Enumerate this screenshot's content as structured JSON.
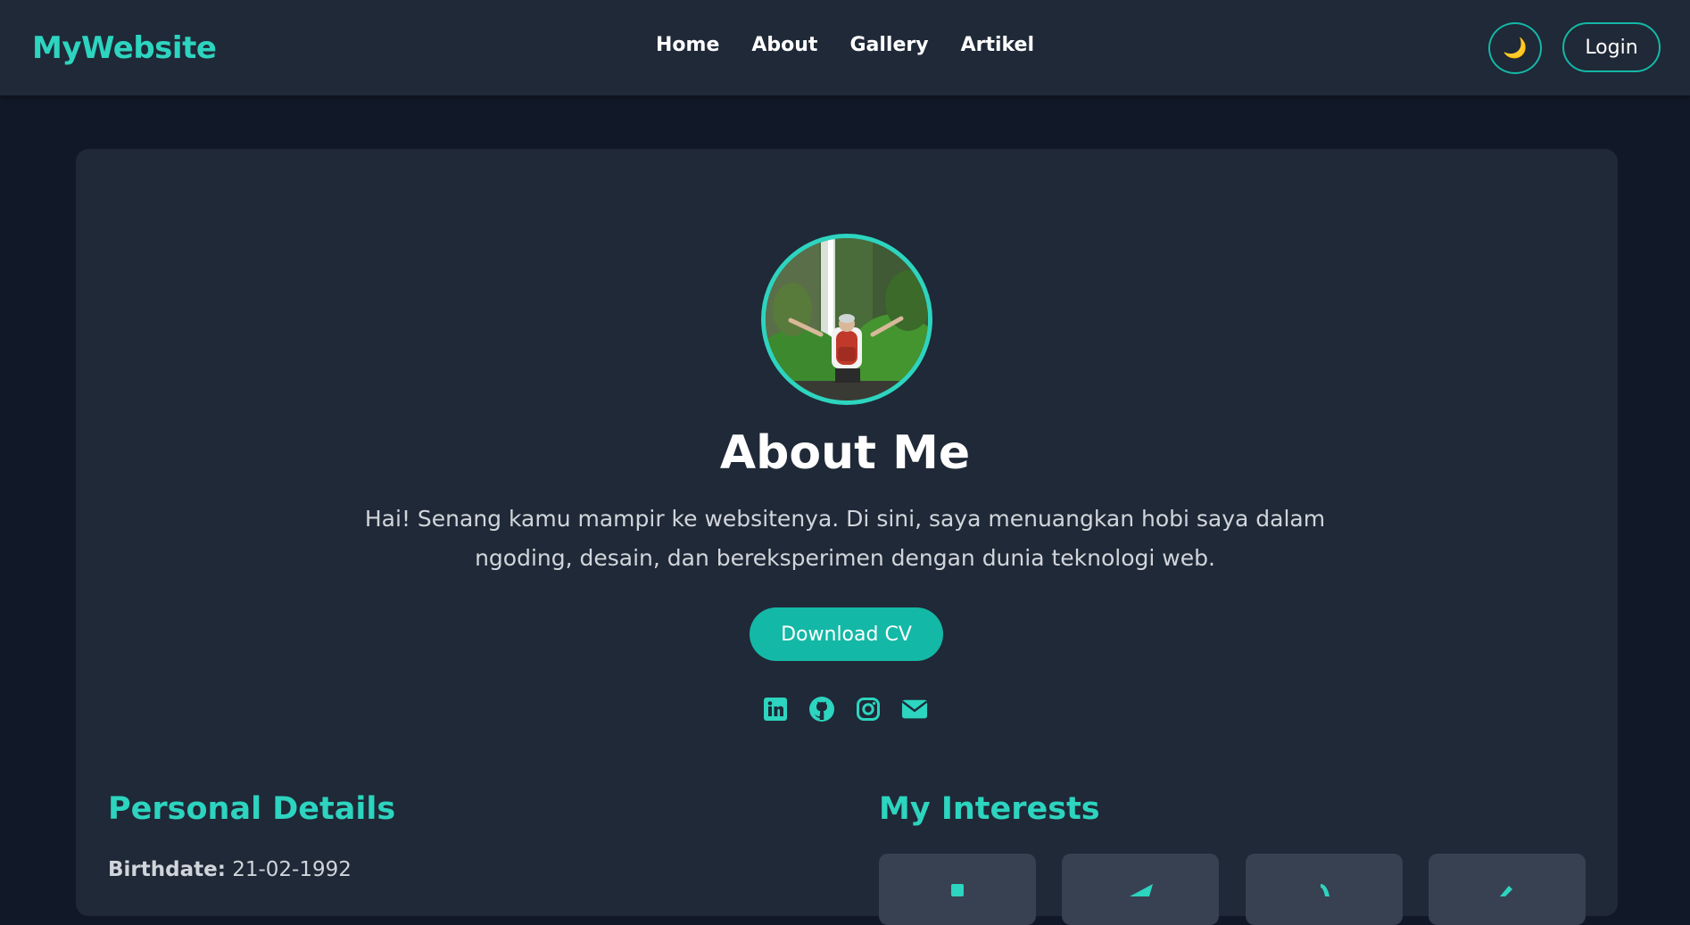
{
  "navbar": {
    "brand": "MyWebsite",
    "links": [
      "Home",
      "About",
      "Gallery",
      "Artikel"
    ],
    "theme_icon": "moon-icon",
    "login_label": "Login"
  },
  "profile": {
    "avatar_icon": "profile-photo-waterfall",
    "title": "About Me",
    "description": "Hai! Senang kamu mampir ke websitenya. Di sini, saya menuangkan hobi saya dalam ngoding, desain, dan bereksperimen dengan dunia teknologi web.",
    "cv_label": "Download CV",
    "socials": [
      "linkedin-icon",
      "github-icon",
      "instagram-icon",
      "envelope-icon"
    ]
  },
  "personal": {
    "title": "Personal Details",
    "birthdate_label": "Birthdate:",
    "birthdate_value": "21-02-1992"
  },
  "interests": {
    "title": "My Interests",
    "tiles": [
      "code-icon",
      "paper-plane-icon",
      "music-icon",
      "brush-icon"
    ]
  },
  "colors": {
    "accent": "#2dd4bf",
    "button": "#14b8a6",
    "page_bg": "#111827",
    "card_bg": "#1f2937"
  }
}
